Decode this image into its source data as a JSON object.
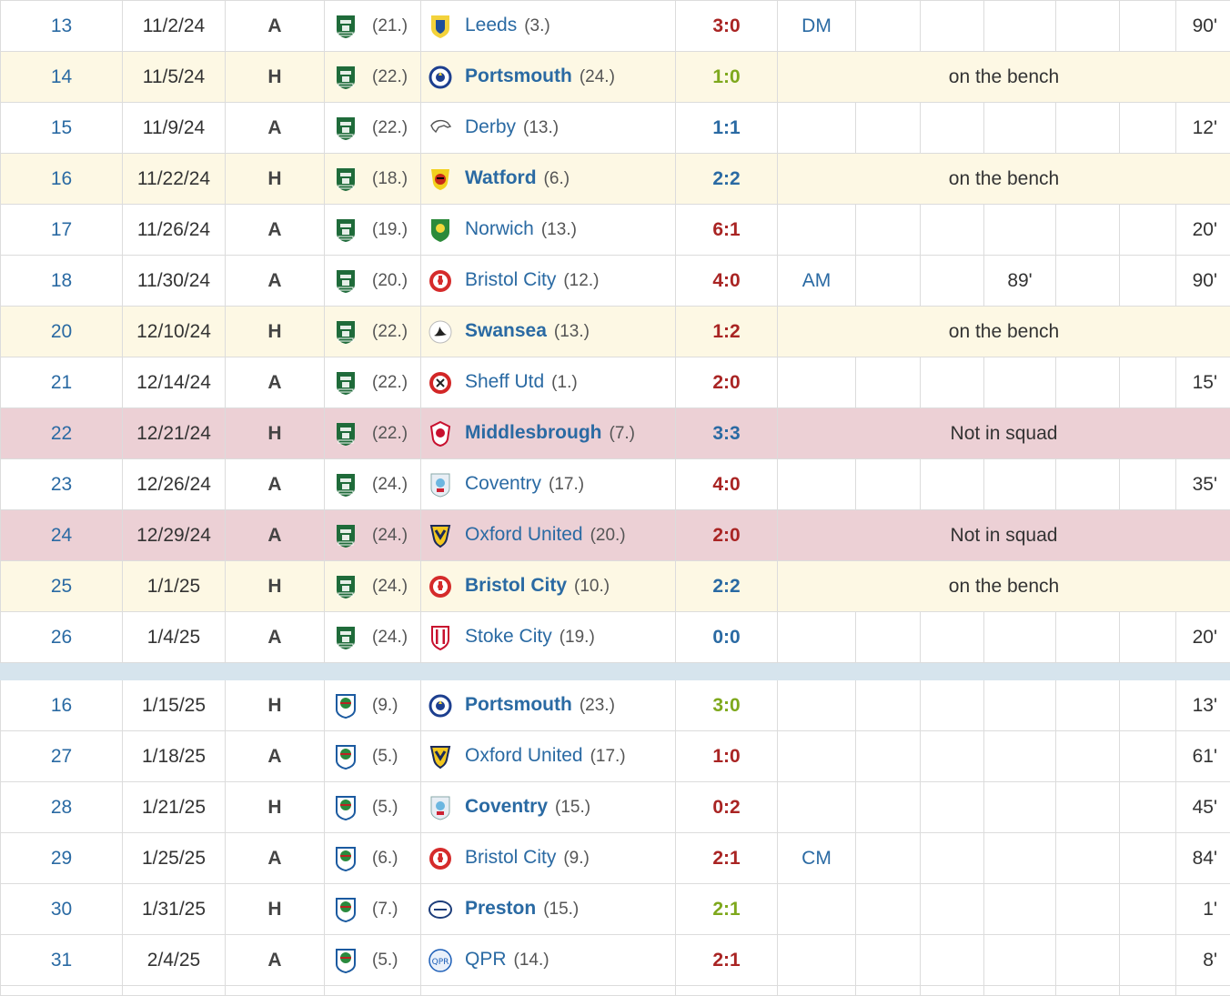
{
  "colors": {
    "win": "#a92423",
    "draw": "#2a6aa3",
    "loss": "#7ea81c",
    "link": "#2a6aa3",
    "bench_bg": "#fdf8e4",
    "notinsquad_bg": "#ecd0d5",
    "separator": "#d6e4ed"
  },
  "section1": [
    {
      "md": "13",
      "date": "11/2/24",
      "venue": "A",
      "own_pos": "(21.)",
      "opp_icon": "leeds-crest-icon",
      "opp": "Leeds",
      "opp_pos": "(3.)",
      "result": "3:0",
      "result_type": "win",
      "home": false,
      "position": "DM",
      "col_g": "",
      "minutes": "90'"
    },
    {
      "md": "14",
      "date": "11/5/24",
      "venue": "H",
      "own_pos": "(22.)",
      "opp_icon": "portsmouth-crest-icon",
      "opp": "Portsmouth",
      "opp_pos": "(24.)",
      "result": "1:0",
      "result_type": "loss",
      "home": true,
      "status": "on the bench",
      "status_type": "bench"
    },
    {
      "md": "15",
      "date": "11/9/24",
      "venue": "A",
      "own_pos": "(22.)",
      "opp_icon": "derby-crest-icon",
      "opp": "Derby",
      "opp_pos": "(13.)",
      "result": "1:1",
      "result_type": "draw",
      "home": false,
      "position": "",
      "col_g": "",
      "minutes": "12'"
    },
    {
      "md": "16",
      "date": "11/22/24",
      "venue": "H",
      "own_pos": "(18.)",
      "opp_icon": "watford-crest-icon",
      "opp": "Watford",
      "opp_pos": "(6.)",
      "result": "2:2",
      "result_type": "draw",
      "home": true,
      "status": "on the bench",
      "status_type": "bench"
    },
    {
      "md": "17",
      "date": "11/26/24",
      "venue": "A",
      "own_pos": "(19.)",
      "opp_icon": "norwich-crest-icon",
      "opp": "Norwich",
      "opp_pos": "(13.)",
      "result": "6:1",
      "result_type": "win",
      "home": false,
      "position": "",
      "col_g": "",
      "minutes": "20'"
    },
    {
      "md": "18",
      "date": "11/30/24",
      "venue": "A",
      "own_pos": "(20.)",
      "opp_icon": "bristol-city-crest-icon",
      "opp": "Bristol City",
      "opp_pos": "(12.)",
      "result": "4:0",
      "result_type": "win",
      "home": false,
      "position": "AM",
      "col_g": "89'",
      "minutes": "90'"
    },
    {
      "md": "20",
      "date": "12/10/24",
      "venue": "H",
      "own_pos": "(22.)",
      "opp_icon": "swansea-crest-icon",
      "opp": "Swansea",
      "opp_pos": "(13.)",
      "result": "1:2",
      "result_type": "win",
      "home": true,
      "status": "on the bench",
      "status_type": "bench"
    },
    {
      "md": "21",
      "date": "12/14/24",
      "venue": "A",
      "own_pos": "(22.)",
      "opp_icon": "sheff-utd-crest-icon",
      "opp": "Sheff Utd",
      "opp_pos": "(1.)",
      "result": "2:0",
      "result_type": "win",
      "home": false,
      "position": "",
      "col_g": "",
      "minutes": "15'"
    },
    {
      "md": "22",
      "date": "12/21/24",
      "venue": "H",
      "own_pos": "(22.)",
      "opp_icon": "middlesbrough-crest-icon",
      "opp": "Middlesbrough",
      "opp_pos": "(7.)",
      "result": "3:3",
      "result_type": "draw",
      "home": true,
      "status": "Not in squad",
      "status_type": "nis"
    },
    {
      "md": "23",
      "date": "12/26/24",
      "venue": "A",
      "own_pos": "(24.)",
      "opp_icon": "coventry-crest-icon",
      "opp": "Coventry",
      "opp_pos": "(17.)",
      "result": "4:0",
      "result_type": "win",
      "home": false,
      "position": "",
      "col_g": "",
      "minutes": "35'"
    },
    {
      "md": "24",
      "date": "12/29/24",
      "venue": "A",
      "own_pos": "(24.)",
      "opp_icon": "oxford-united-crest-icon",
      "opp": "Oxford United",
      "opp_pos": "(20.)",
      "result": "2:0",
      "result_type": "win",
      "home": false,
      "status": "Not in squad",
      "status_type": "nis"
    },
    {
      "md": "25",
      "date": "1/1/25",
      "venue": "H",
      "own_pos": "(24.)",
      "opp_icon": "bristol-city-crest-icon",
      "opp": "Bristol City",
      "opp_pos": "(10.)",
      "result": "2:2",
      "result_type": "draw",
      "home": true,
      "status": "on the bench",
      "status_type": "bench"
    },
    {
      "md": "26",
      "date": "1/4/25",
      "venue": "A",
      "own_pos": "(24.)",
      "opp_icon": "stoke-city-crest-icon",
      "opp": "Stoke City",
      "opp_pos": "(19.)",
      "result": "0:0",
      "result_type": "draw",
      "home": false,
      "position": "",
      "col_g": "",
      "minutes": "20'"
    }
  ],
  "section2": [
    {
      "md": "16",
      "date": "1/15/25",
      "venue": "H",
      "own_pos": "(9.)",
      "opp_icon": "portsmouth-crest-icon",
      "opp": "Portsmouth",
      "opp_pos": "(23.)",
      "result": "3:0",
      "result_type": "loss",
      "home": true,
      "position": "",
      "col_g": "",
      "minutes": "13'"
    },
    {
      "md": "27",
      "date": "1/18/25",
      "venue": "A",
      "own_pos": "(5.)",
      "opp_icon": "oxford-united-crest-icon",
      "opp": "Oxford United",
      "opp_pos": "(17.)",
      "result": "1:0",
      "result_type": "win",
      "home": false,
      "position": "",
      "col_g": "",
      "minutes": "61'"
    },
    {
      "md": "28",
      "date": "1/21/25",
      "venue": "H",
      "own_pos": "(5.)",
      "opp_icon": "coventry-crest-icon",
      "opp": "Coventry",
      "opp_pos": "(15.)",
      "result": "0:2",
      "result_type": "win",
      "home": true,
      "position": "",
      "col_g": "",
      "minutes": "45'"
    },
    {
      "md": "29",
      "date": "1/25/25",
      "venue": "A",
      "own_pos": "(6.)",
      "opp_icon": "bristol-city-crest-icon",
      "opp": "Bristol City",
      "opp_pos": "(9.)",
      "result": "2:1",
      "result_type": "win",
      "home": false,
      "position": "CM",
      "col_g": "",
      "minutes": "84'"
    },
    {
      "md": "30",
      "date": "1/31/25",
      "venue": "H",
      "own_pos": "(7.)",
      "opp_icon": "preston-crest-icon",
      "opp": "Preston",
      "opp_pos": "(15.)",
      "result": "2:1",
      "result_type": "loss",
      "home": true,
      "position": "",
      "col_g": "",
      "minutes": "1'"
    },
    {
      "md": "31",
      "date": "2/4/25",
      "venue": "A",
      "own_pos": "(5.)",
      "opp_icon": "qpr-crest-icon",
      "opp": "QPR",
      "opp_pos": "(14.)",
      "result": "2:1",
      "result_type": "win",
      "home": false,
      "position": "",
      "col_g": "",
      "minutes": "8'"
    }
  ]
}
